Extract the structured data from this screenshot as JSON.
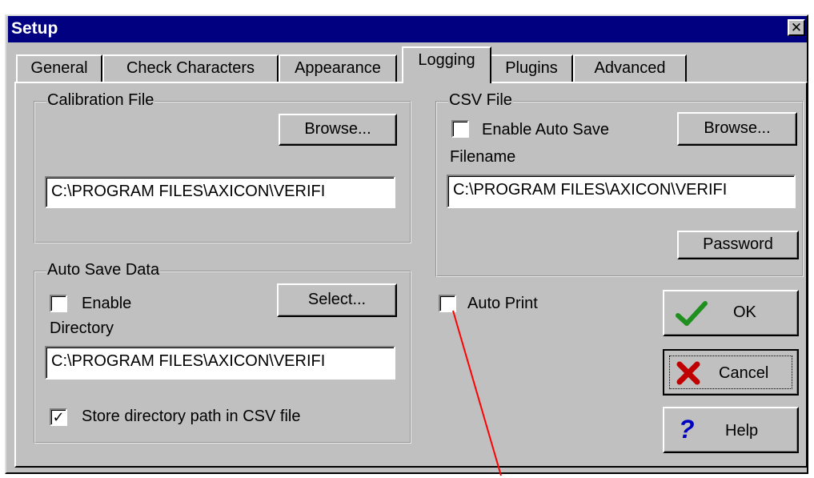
{
  "window": {
    "title": "Setup",
    "close_label": "✕"
  },
  "tabs": [
    {
      "label": "General"
    },
    {
      "label": "Check Characters"
    },
    {
      "label": "Appearance"
    },
    {
      "label": "Logging"
    },
    {
      "label": "Plugins"
    },
    {
      "label": "Advanced"
    }
  ],
  "calibration": {
    "title": "Calibration File",
    "browse_label": "Browse...",
    "path": "C:\\PROGRAM FILES\\AXICON\\VERIFI"
  },
  "csv": {
    "title": "CSV File",
    "enable_label": "Enable Auto Save",
    "enable_checked": false,
    "browse_label": "Browse...",
    "filename_label": "Filename",
    "path": "C:\\PROGRAM FILES\\AXICON\\VERIFI",
    "password_label": "Password"
  },
  "autosave": {
    "title": "Auto Save Data",
    "enable_label": "Enable",
    "enable_checked": false,
    "select_label": "Select...",
    "directory_label": "Directory",
    "path": "C:\\PROGRAM FILES\\AXICON\\VERIFI",
    "store_label": "Store directory path in CSV file",
    "store_checked": true
  },
  "auto_print": {
    "label": "Auto Print",
    "checked": false
  },
  "buttons": {
    "ok": "OK",
    "cancel": "Cancel",
    "help": "Help"
  },
  "icons": {
    "ok": "checkmark-icon",
    "cancel": "x-icon",
    "help": "question-icon"
  },
  "colors": {
    "titlebar": "#000080",
    "ok_icon": "#1f8f1f",
    "cancel_icon": "#c00000",
    "help_icon": "#0000c0",
    "annotation": "#ff0000"
  }
}
